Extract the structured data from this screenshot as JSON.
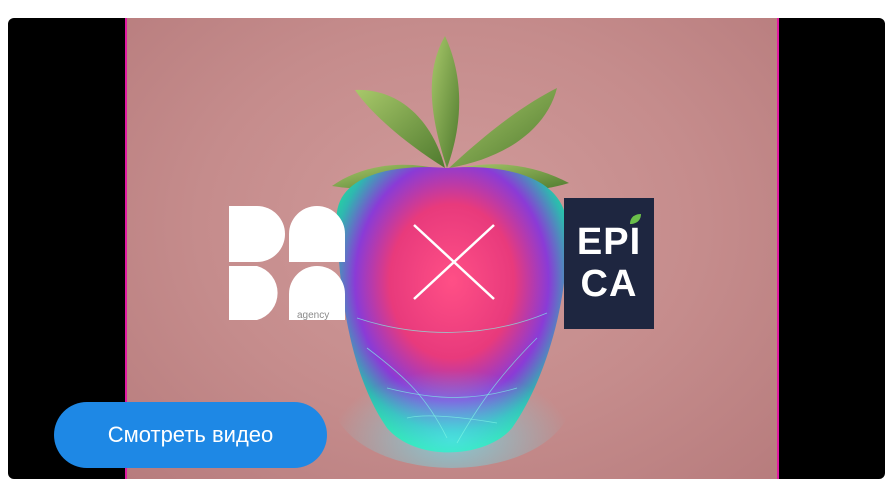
{
  "video": {
    "left_brand": {
      "logo_text": "DADA",
      "sub_label": "agency"
    },
    "right_brand": {
      "line1": "EPI",
      "line2": "CA",
      "box_color": "#1e2640"
    },
    "collab_icon": "x-mark-icon",
    "frame_accent": "#e21aa2",
    "background_color": "#c58c8c"
  },
  "cta": {
    "label": "Смотреть видео",
    "color": "#1e88e5"
  }
}
